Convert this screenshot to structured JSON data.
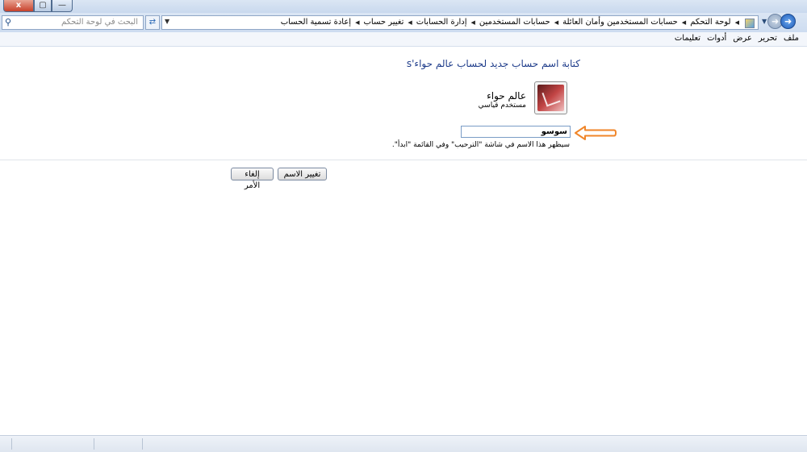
{
  "window": {
    "caption_buttons": [
      {
        "name": "close",
        "glyph": "x"
      },
      {
        "name": "maximize",
        "glyph": "▢"
      },
      {
        "name": "minimize",
        "glyph": "—"
      }
    ]
  },
  "search": {
    "placeholder": "البحث في لوحة التحكم",
    "icon": "search-icon"
  },
  "address": {
    "breadcrumbs": [
      "لوحة التحكم",
      "حسابات المستخدمين وأمان العائلة",
      "حسابات المستخدمين",
      "إدارة الحسابات",
      "تغيير حساب",
      "إعادة تسمية الحساب"
    ]
  },
  "menu": {
    "items": [
      "ملف",
      "تحرير",
      "عرض",
      "أدوات",
      "تعليمات"
    ]
  },
  "main": {
    "heading": "كتابة اسم حساب جديد لحساب عالم حواء's",
    "account": {
      "name": "عالم حواء",
      "type": "مستخدم قياسي"
    },
    "new_name_value": "سوسو",
    "hint": "سيظهر هذا الاسم في شاشة \"الترحيب\" وفي القائمة \"ابدأ\".",
    "annotation_color": "#f0862a"
  },
  "buttons": {
    "change_name": "تغيير الاسم",
    "cancel": "إلغاء الأمر"
  }
}
